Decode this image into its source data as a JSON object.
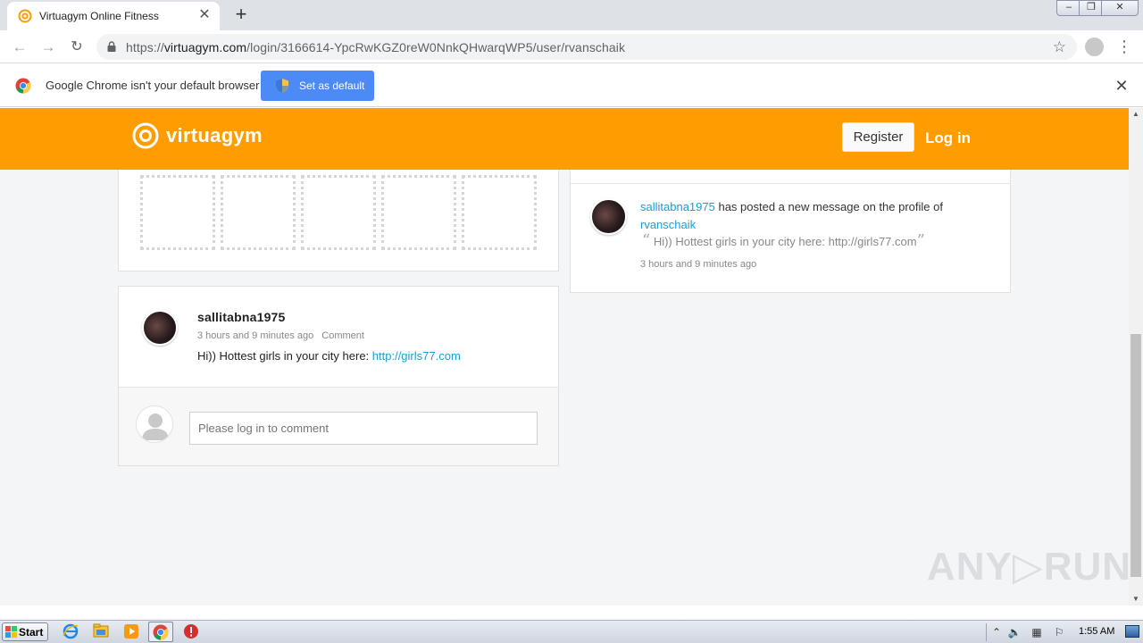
{
  "browser": {
    "tab": {
      "title": "Virtuagym Online Fitness"
    },
    "url": {
      "scheme": "https://",
      "host": "virtuagym.com",
      "path": "/login/3166614-YpcRwKGZ0reW0NnkQHwarqWP5/user/rvanschaik"
    },
    "infobar": {
      "message": "Google Chrome isn't your default browser",
      "button": "Set as default"
    }
  },
  "site": {
    "brand": "virtuagym",
    "register_label": "Register",
    "login_label": "Log in",
    "brand_color": "#ff9c00"
  },
  "post": {
    "author": "sallitabna1975",
    "time": "3 hours and 9 minutes ago",
    "comment_link": "Comment",
    "text": "Hi)) Hottest girls in your city here: ",
    "link": "http://girls77.com",
    "comment_placeholder": "Please log in to comment"
  },
  "activity": {
    "actor": "sallitabna1975",
    "action": " has posted a new message on the profile of",
    "target": "rvanschaik",
    "quote_open": "“",
    "quote": " Hi)) Hottest girls in your city here: http://girls77.com",
    "quote_close": "”",
    "time": "3 hours and 9 minutes ago"
  },
  "watermark": "ANY▷RUN",
  "taskbar": {
    "start_label": "Start",
    "clock": "1:55 AM"
  }
}
